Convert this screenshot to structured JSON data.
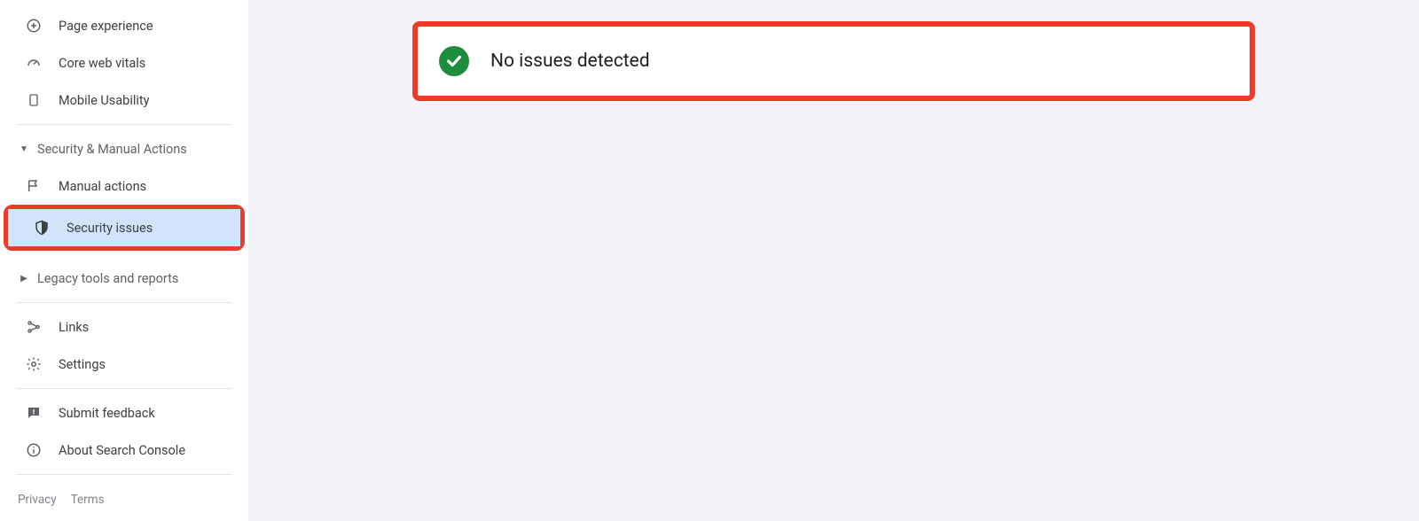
{
  "sidebar": {
    "items": [
      {
        "label": "Page experience"
      },
      {
        "label": "Core web vitals"
      },
      {
        "label": "Mobile Usability"
      }
    ],
    "security_section": {
      "header": "Security & Manual Actions",
      "items": [
        {
          "label": "Manual actions"
        },
        {
          "label": "Security issues"
        }
      ]
    },
    "legacy_section": {
      "header": "Legacy tools and reports"
    },
    "bottom_items": [
      {
        "label": "Links"
      },
      {
        "label": "Settings"
      }
    ],
    "support_items": [
      {
        "label": "Submit feedback"
      },
      {
        "label": "About Search Console"
      }
    ],
    "footer": {
      "privacy": "Privacy",
      "terms": "Terms"
    }
  },
  "main": {
    "status_message": "No issues detected"
  }
}
